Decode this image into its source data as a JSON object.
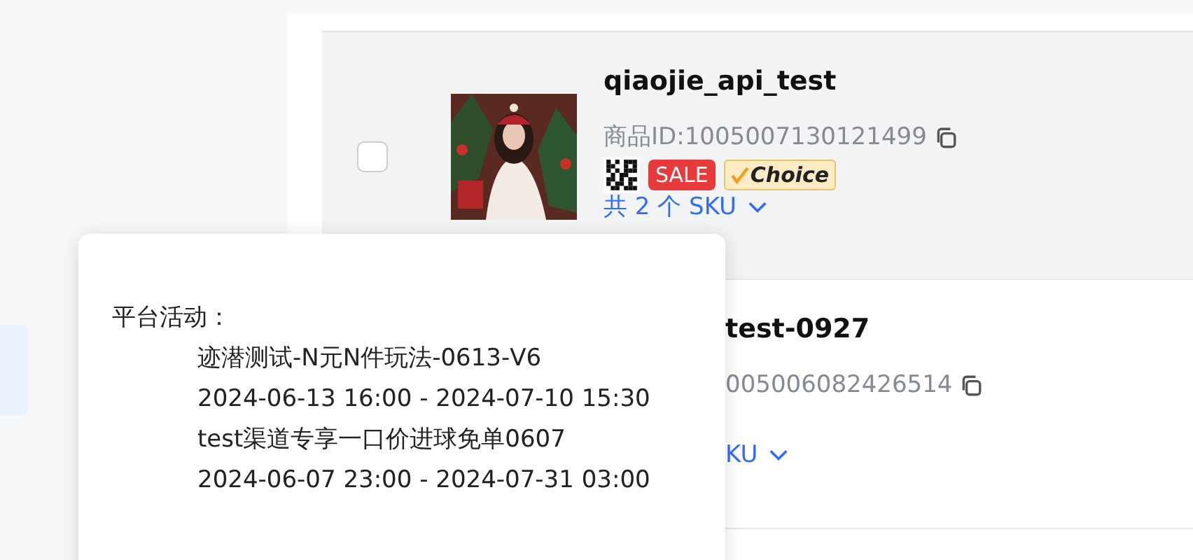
{
  "products": [
    {
      "title": "qiaojie_api_test",
      "product_id": "商品ID:1005007130121499",
      "checked": false,
      "badges": [
        {
          "kind": "qr"
        },
        {
          "kind": "sale",
          "text": "SALE"
        },
        {
          "kind": "choice",
          "text": "Choice"
        }
      ],
      "sku": "共 2 个 SKU"
    },
    {
      "title": "test-0927",
      "product_id": "005006082426514",
      "sku": "KU"
    }
  ],
  "tooltip": {
    "heading": "平台活动：",
    "activities": [
      {
        "name": "迹潜测试-N元N件玩法-0613-V6",
        "period": "2024-06-13 16:00 - 2024-07-10 15:30"
      },
      {
        "name": "test渠道专享一口价进球免单0607",
        "period": "2024-06-07 23:00 - 2024-07-31 03:00"
      }
    ]
  }
}
